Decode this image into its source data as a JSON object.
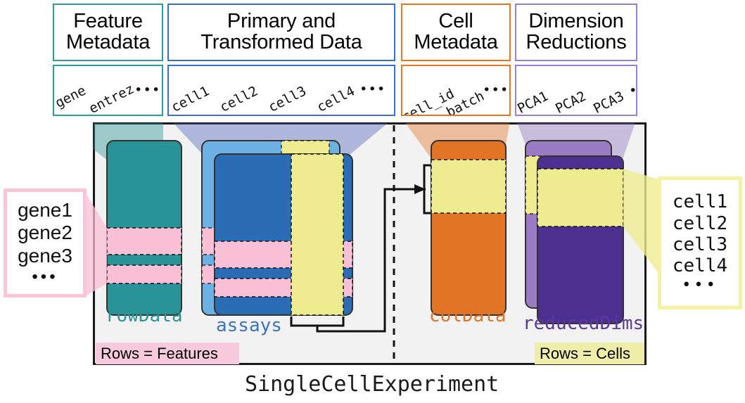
{
  "diagram": {
    "caption": "SingleCellExperiment",
    "panel_divider": "dashed-vertical"
  },
  "headers": [
    {
      "id": "feature-metadata",
      "title": "Feature\nMetadata",
      "color": "#2a9d94",
      "columns": [
        "gene",
        "entrez"
      ],
      "ellipsis": "•••"
    },
    {
      "id": "primary-transformed-data",
      "title": "Primary and\nTransformed Data",
      "color": "#3b6fc4",
      "columns": [
        "cell1",
        "cell2",
        "cell3",
        "cell4"
      ],
      "ellipsis": "•••"
    },
    {
      "id": "cell-metadata",
      "title": "Cell\nMetadata",
      "color": "#e8761f",
      "columns": [
        "cell_id",
        "batch"
      ],
      "ellipsis": "•••"
    },
    {
      "id": "dimension-reductions",
      "title": "Dimension\nReductions",
      "color": "#9b7fd4",
      "columns": [
        "PCA1",
        "PCA2",
        "PCA3"
      ],
      "ellipsis": "•••"
    }
  ],
  "slots": [
    {
      "id": "rowData",
      "label": "rowData",
      "color": "#2a9398"
    },
    {
      "id": "assays",
      "label": "assays",
      "color": "#3b74c0"
    },
    {
      "id": "colData",
      "label": "colData",
      "color": "#e27425"
    },
    {
      "id": "reducedDims",
      "label": "reducedDims",
      "color": "#5b3a9e"
    }
  ],
  "badges": {
    "features": {
      "text": "Rows = Features",
      "bg": "#f7cbdd",
      "border": "#d79ab6"
    },
    "cells": {
      "text": "Rows = Cells",
      "bg": "#eeeeaa",
      "border": "#d8d87a"
    }
  },
  "callouts": {
    "genes": {
      "items": [
        "gene1",
        "gene2",
        "gene3"
      ],
      "ellipsis": "•••",
      "border": "#f9c6d9",
      "font": "sans"
    },
    "cells": {
      "items": [
        "cell1",
        "cell2",
        "cell3",
        "cell4"
      ],
      "ellipsis": "•••",
      "border": "#f2f2a0",
      "font": "mono"
    }
  },
  "palette": {
    "teal": "#2a9398",
    "teal_header": "#2a9d94",
    "blue": "#2a6db5",
    "blue_light": "#6cb0e4",
    "blue_header": "#3b6fc4",
    "orange": "#e27425",
    "orange_header": "#e8761f",
    "purple_dark": "#4c2f8f",
    "purple_light": "#9b7cc4",
    "purple_header": "#9b7fd4",
    "pink": "#f9bfd6",
    "yellow": "#efeb90",
    "panel_bg": "#f2f2f2",
    "panel_border": "#1a1a1a"
  }
}
